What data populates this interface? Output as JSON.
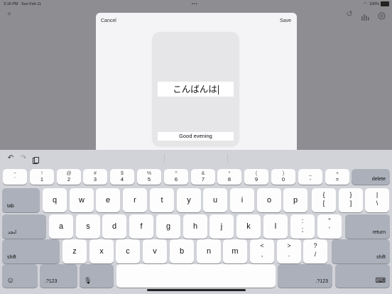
{
  "status_bar": {
    "time": "3:16 PM",
    "date": "Sun Feb 11",
    "battery": "100%"
  },
  "app_bar": {
    "add_icon": "plus-icon",
    "right_icons": [
      "undo-icon",
      "chart-icon",
      "settings-icon"
    ]
  },
  "sheet": {
    "cancel": "Cancel",
    "save": "Save",
    "card_text": "こんばんは",
    "card_caption": "Good evening"
  },
  "keyboard": {
    "assist_icons": [
      "undo-icon",
      "redo-icon",
      "paste-icon"
    ],
    "number_row": [
      {
        "top": "~",
        "bottom": "`"
      },
      {
        "top": "!",
        "bottom": "1"
      },
      {
        "top": "@",
        "bottom": "2"
      },
      {
        "top": "#",
        "bottom": "3"
      },
      {
        "top": "$",
        "bottom": "4"
      },
      {
        "top": "%",
        "bottom": "5"
      },
      {
        "top": "^",
        "bottom": "6"
      },
      {
        "top": "&",
        "bottom": "7"
      },
      {
        "top": "*",
        "bottom": "8"
      },
      {
        "top": "(",
        "bottom": "9"
      },
      {
        "top": ")",
        "bottom": "0"
      },
      {
        "top": "_",
        "bottom": "-"
      },
      {
        "top": "+",
        "bottom": "="
      }
    ],
    "delete": "delete",
    "tab": "tab",
    "row_q": [
      "q",
      "w",
      "e",
      "r",
      "t",
      "y",
      "u",
      "i",
      "o",
      "p"
    ],
    "row_q_extra": [
      {
        "top": "{",
        "bottom": "["
      },
      {
        "top": "}",
        "bottom": "]"
      },
      {
        "top": "|",
        "bottom": "\\"
      }
    ],
    "lang": "ابجد",
    "row_a": [
      "a",
      "s",
      "d",
      "f",
      "g",
      "h",
      "j",
      "k",
      "l"
    ],
    "row_a_extra": [
      {
        "top": ":",
        "bottom": ";"
      },
      {
        "top": "\"",
        "bottom": "'"
      }
    ],
    "return": "return",
    "shift": "shift",
    "row_z": [
      "z",
      "x",
      "c",
      "v",
      "b",
      "n",
      "m"
    ],
    "row_z_extra": [
      {
        "top": "<",
        "bottom": ","
      },
      {
        "top": ">",
        "bottom": "."
      },
      {
        "top": "?",
        "bottom": "/"
      }
    ],
    "mode": ".?123",
    "space": ""
  }
}
